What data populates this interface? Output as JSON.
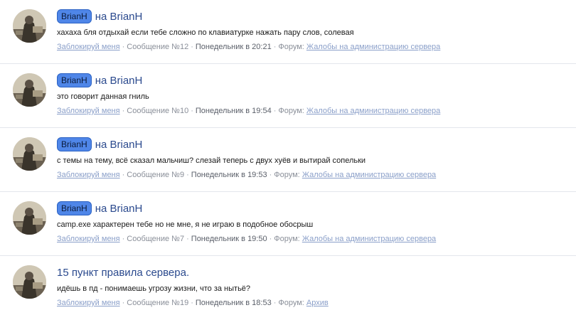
{
  "items": [
    {
      "user_badge": "BrianH",
      "title": "на BrianH",
      "snippet": "хахаха бля отдыхай если тебе сложно по клавиатурке нажать пару слов, солевая",
      "block_link": "Заблокируй меня",
      "message": "Сообщение №12",
      "date": "Понедельник в 20:21",
      "forum_label": "Форум:",
      "forum_link": "Жалобы на администрацию сервера"
    },
    {
      "user_badge": "BrianH",
      "title": "на BrianH",
      "snippet": "это говорит данная гниль",
      "block_link": "Заблокируй меня",
      "message": "Сообщение №10",
      "date": "Понедельник в 19:54",
      "forum_label": "Форум:",
      "forum_link": "Жалобы на администрацию сервера"
    },
    {
      "user_badge": "BrianH",
      "title": "на BrianH",
      "snippet": "с темы на тему, всё сказал мальчиш? слезай теперь с двух хуёв и вытирай сопельки",
      "block_link": "Заблокируй меня",
      "message": "Сообщение №9",
      "date": "Понедельник в 19:53",
      "forum_label": "Форум:",
      "forum_link": "Жалобы на администрацию сервера"
    },
    {
      "user_badge": "BrianH",
      "title": "на BrianH",
      "snippet": "camp.exe характерен тебе но не мне, я не играю в подобное обосрыш",
      "block_link": "Заблокируй меня",
      "message": "Сообщение №7",
      "date": "Понедельник в 19:50",
      "forum_label": "Форум:",
      "forum_link": "Жалобы на администрацию сервера"
    },
    {
      "user_badge": "",
      "title": "15 пункт правила сервера.",
      "snippet": "идёшь в пд - понимаешь угрозу жизни, что за нытьё?",
      "block_link": "Заблокируй меня",
      "message": "Сообщение №19",
      "date": "Понедельник в 18:53",
      "forum_label": "Форум:",
      "forum_link": "Архив"
    }
  ],
  "separator": "·",
  "colors": {
    "badge_bg": "#4f86e8",
    "title": "#2b4a8e",
    "link": "#8a9fc9",
    "meta": "#8a8f99"
  }
}
